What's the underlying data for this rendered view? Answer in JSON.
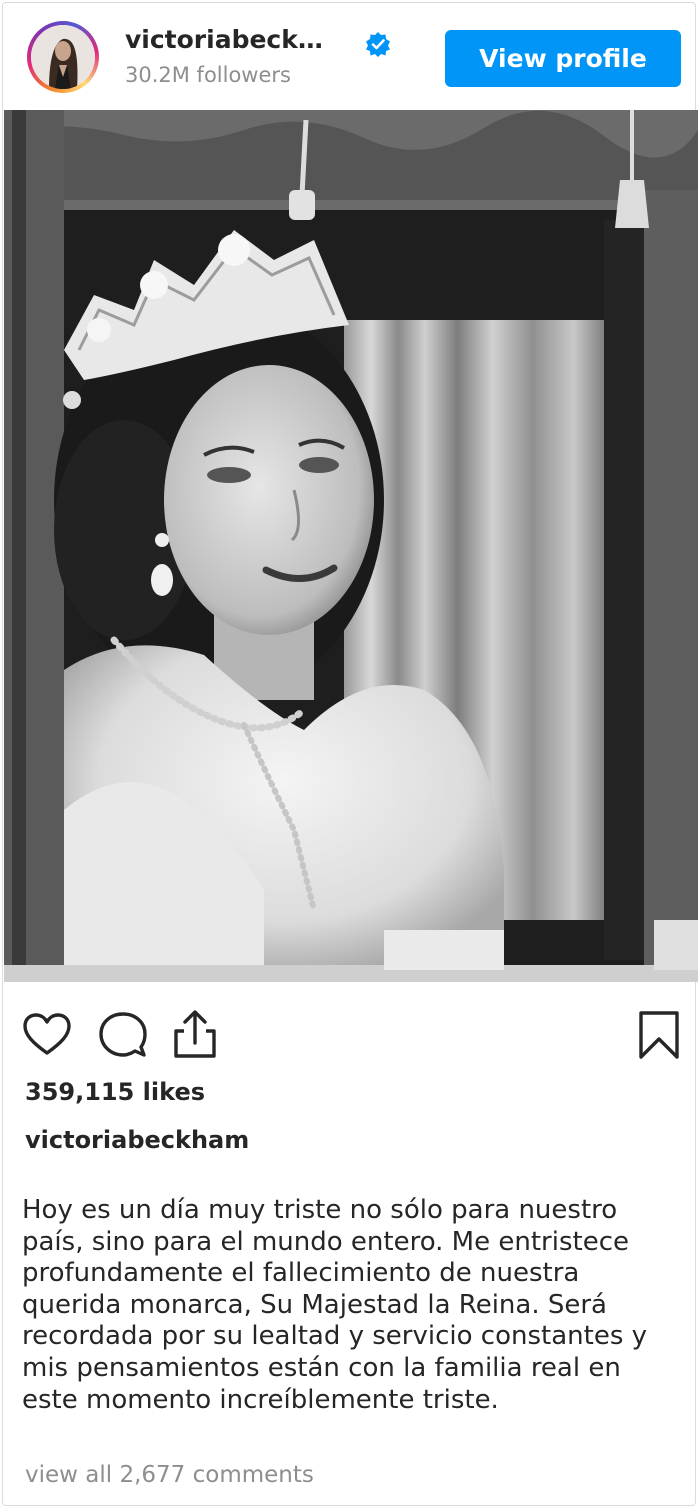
{
  "header": {
    "username": "victoriabeck…",
    "followers": "30.2M followers",
    "view_profile_label": "View profile",
    "verified_icon": "verified-badge-icon"
  },
  "post": {
    "image_alt": "Black and white portrait of Queen Elizabeth II wearing a tiara",
    "likes": "359,115 likes",
    "caption_username": "victoriabeckham",
    "caption": "Hoy es un día muy triste no sólo para nuestro país, sino para el mundo entero. Me entristece profundamente el fallecimiento de nuestra querida monarca, Su Majestad la Reina. Será recordada por su lealtad y servicio constantes y mis pensamientos están con la familia real en este momento increíblemente triste.",
    "view_comments": "view all 2,677 comments"
  },
  "actions": {
    "like_icon": "heart-icon",
    "comment_icon": "comment-icon",
    "share_icon": "share-icon",
    "save_icon": "bookmark-icon"
  },
  "colors": {
    "accent": "#0095f6",
    "text": "#262626",
    "muted": "#8e8e8e",
    "border": "#dbdbdb"
  }
}
